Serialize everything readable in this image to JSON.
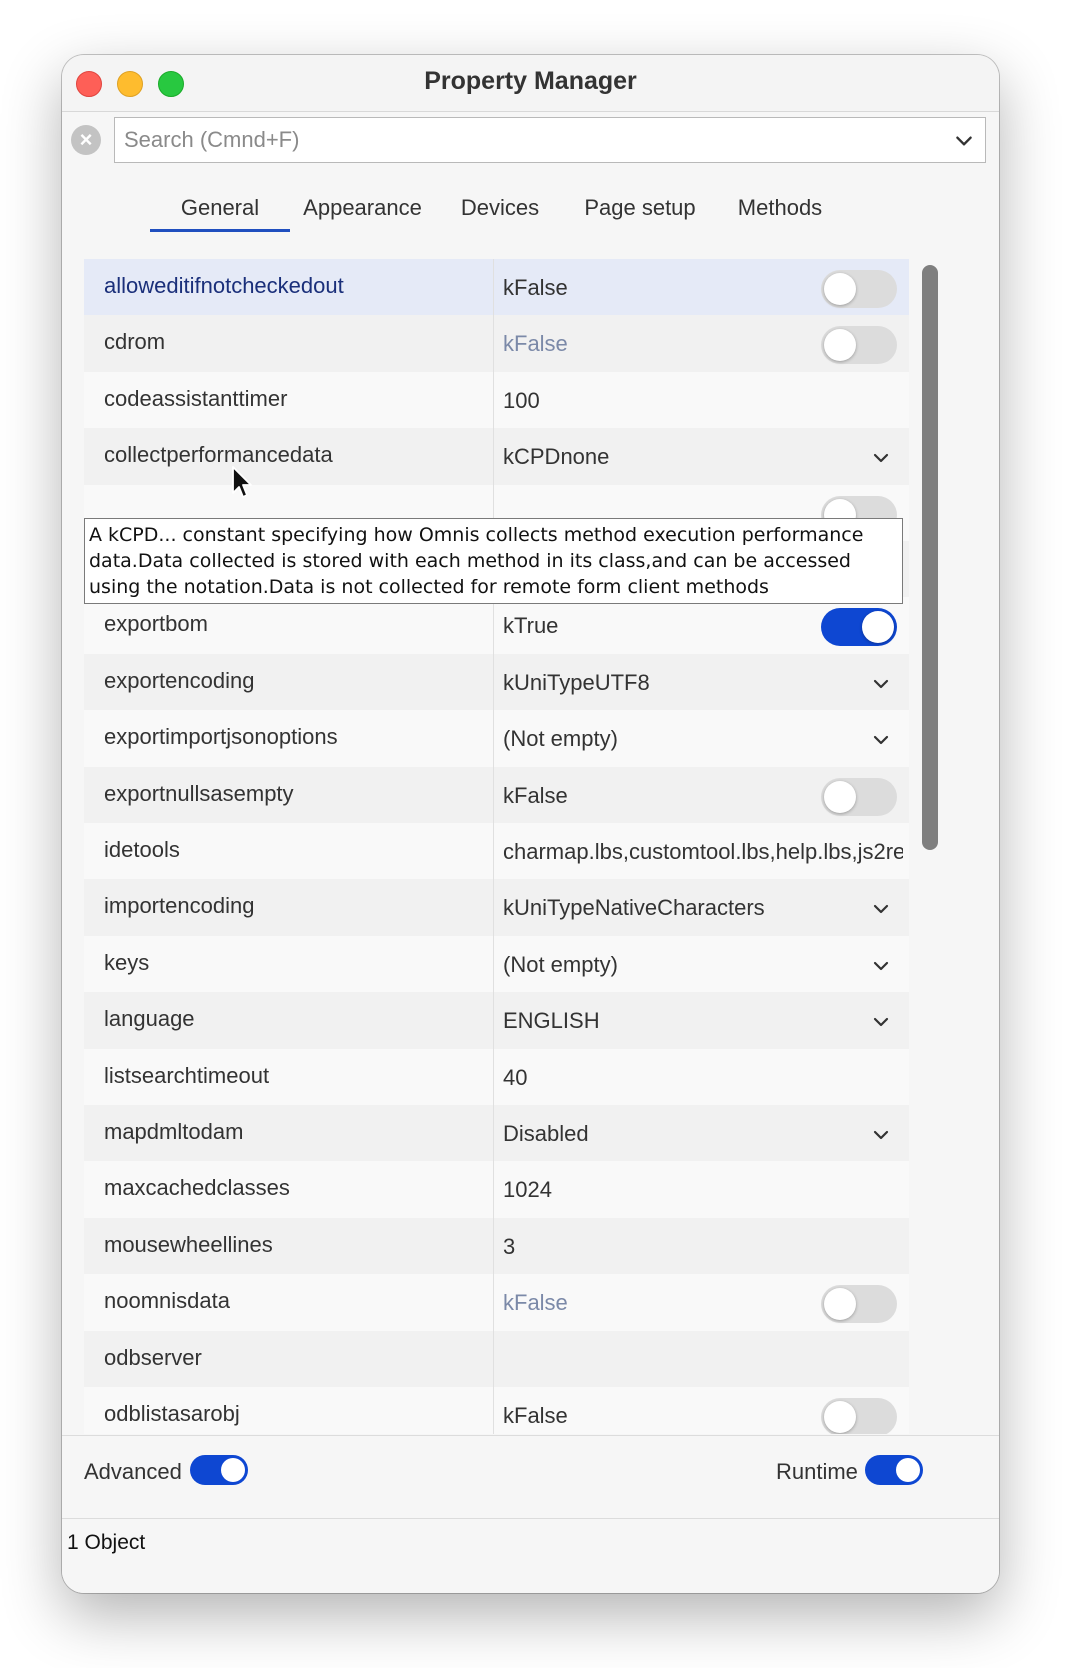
{
  "window": {
    "title": "Property Manager"
  },
  "search": {
    "placeholder": "Search (Cmnd+F)",
    "value": ""
  },
  "tabs": [
    {
      "label": "General",
      "active": true
    },
    {
      "label": "Appearance",
      "active": false
    },
    {
      "label": "Devices",
      "active": false
    },
    {
      "label": "Page setup",
      "active": false
    },
    {
      "label": "Methods",
      "active": false
    }
  ],
  "properties": [
    {
      "name": "alloweditifnotcheckedout",
      "value": "kFalse",
      "control": "toggle",
      "on": false,
      "selected": true
    },
    {
      "name": "cdrom",
      "value": "kFalse",
      "control": "toggle",
      "on": false,
      "dim": true
    },
    {
      "name": "codeassistanttimer",
      "value": "100",
      "control": "none"
    },
    {
      "name": "collectperformancedata",
      "value": "kCPDnone",
      "control": "dropdown"
    },
    {
      "name": "",
      "value": "",
      "control": "toggle",
      "on": false,
      "hidden": true
    },
    {
      "name": "",
      "value": "",
      "control": "none",
      "hidden": true
    },
    {
      "name": "exportbom",
      "value": "kTrue",
      "control": "toggle",
      "on": true
    },
    {
      "name": "exportencoding",
      "value": "kUniTypeUTF8",
      "control": "dropdown"
    },
    {
      "name": "exportimportjsonoptions",
      "value": "(Not empty)",
      "control": "dropdown"
    },
    {
      "name": "exportnullsasempty",
      "value": "kFalse",
      "control": "toggle",
      "on": false
    },
    {
      "name": "idetools",
      "value": "charmap.lbs,customtool.lbs,help.lbs,js2re",
      "control": "none"
    },
    {
      "name": "importencoding",
      "value": "kUniTypeNativeCharacters",
      "control": "dropdown"
    },
    {
      "name": "keys",
      "value": "(Not empty)",
      "control": "dropdown"
    },
    {
      "name": "language",
      "value": "ENGLISH",
      "control": "dropdown"
    },
    {
      "name": "listsearchtimeout",
      "value": "40",
      "control": "none"
    },
    {
      "name": "mapdmltodam",
      "value": "Disabled",
      "control": "dropdown"
    },
    {
      "name": "maxcachedclasses",
      "value": "1024",
      "control": "none"
    },
    {
      "name": "mousewheellines",
      "value": "3",
      "control": "none"
    },
    {
      "name": "noomnisdata",
      "value": "kFalse",
      "control": "toggle",
      "on": false,
      "dim": true
    },
    {
      "name": "odbserver",
      "value": "",
      "control": "none"
    },
    {
      "name": "odblistasarobj",
      "value": "kFalse",
      "control": "toggle",
      "on": false,
      "clipped": true
    }
  ],
  "tooltip": {
    "text": "A kCPD... constant specifying how Omnis collects method execution performance data.Data collected is stored with each method in its class,and can be accessed using the notation.Data is not collected for remote form client methods"
  },
  "footer": {
    "advanced_label": "Advanced",
    "advanced_on": true,
    "runtime_label": "Runtime",
    "runtime_on": true
  },
  "status": {
    "text": "1 Object"
  },
  "colors": {
    "accent": "#0e47d2",
    "selected_row": "#e5eaf7",
    "tab_underline": "#1f4fbf"
  }
}
